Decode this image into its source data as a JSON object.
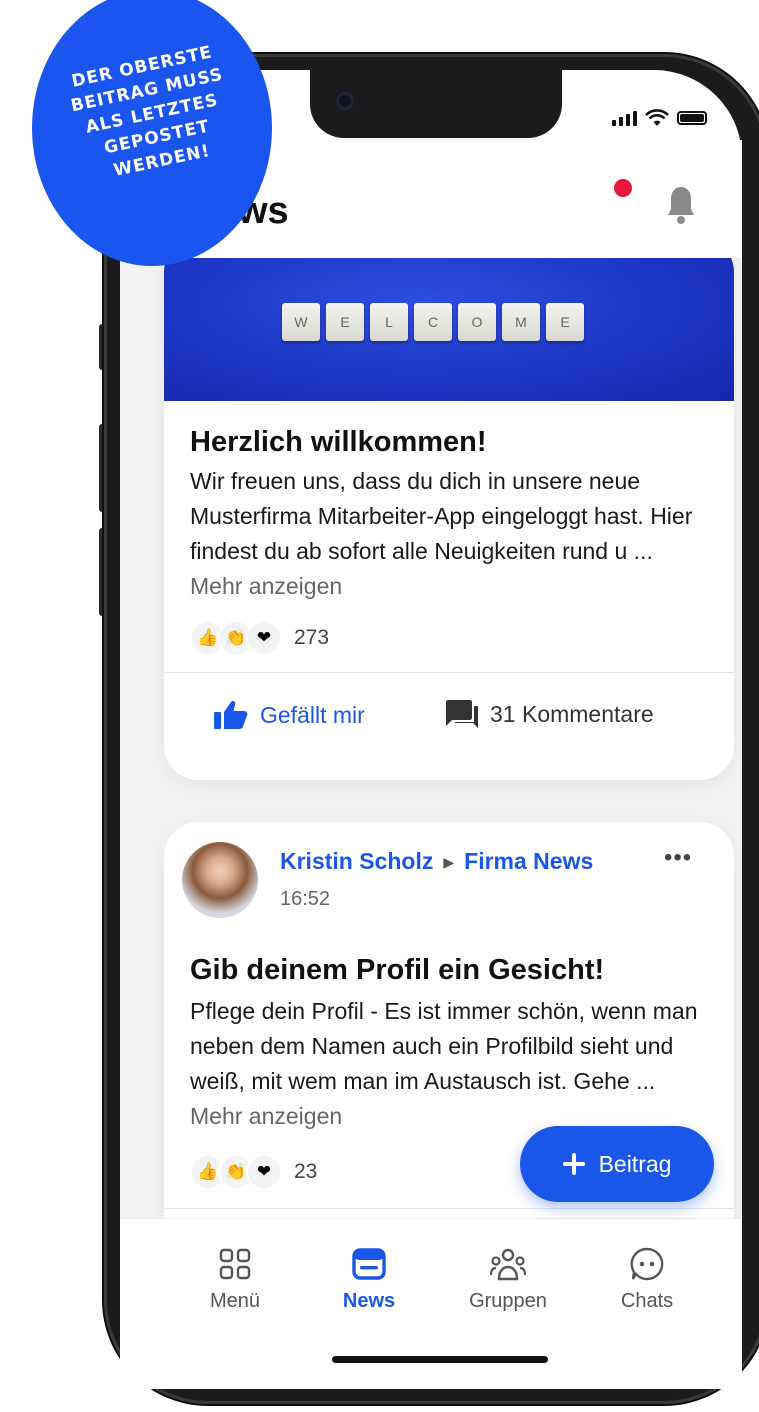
{
  "sticker": {
    "line1": "DER OBERSTE",
    "line2": "BEITRAG MUSS",
    "line3": "ALS LETZTES",
    "line4": "GEPOSTET",
    "line5": "WERDEN!"
  },
  "header": {
    "title": "ws"
  },
  "posts": [
    {
      "banner_letters": [
        "W",
        "E",
        "L",
        "C",
        "O",
        "M",
        "E"
      ],
      "title": "Herzlich willkommen!",
      "body": "Wir freuen uns, dass du dich in unsere neue Musterfirma Mitarbeiter-App eingeloggt hast. Hier findest du ab sofort alle Neuigkeiten rund u",
      "ellipsis": "...",
      "more_label": "Mehr anzeigen",
      "reaction_count": "273",
      "like_label": "Gefällt mir",
      "comments_label": "31 Kommentare"
    },
    {
      "author": "Kristin Scholz",
      "channel": "Firma News",
      "time": "16:52",
      "title": "Gib deinem Profil ein Gesicht!",
      "body": "Pflege dein Profil - Es ist immer schön, wenn man neben dem Namen auch ein Profilbild sieht und weiß, mit wem man im Austausch ist. Gehe",
      "ellipsis": "...",
      "more_label": "Mehr anzeigen",
      "reaction_count": "23"
    }
  ],
  "fab": {
    "label": "Beitrag"
  },
  "tabs": [
    {
      "label": "Menü",
      "icon": "grid-icon"
    },
    {
      "label": "News",
      "icon": "news-icon",
      "active": true
    },
    {
      "label": "Gruppen",
      "icon": "groups-icon"
    },
    {
      "label": "Chats",
      "icon": "chat-icon"
    }
  ],
  "colors": {
    "accent": "#1a57e8",
    "sticker": "#1a55f0",
    "notification": "#e8163a"
  }
}
